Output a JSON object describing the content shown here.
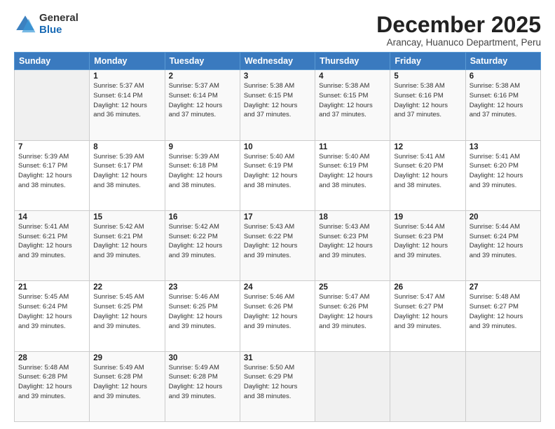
{
  "logo": {
    "general": "General",
    "blue": "Blue"
  },
  "header": {
    "title": "December 2025",
    "subtitle": "Arancay, Huanuco Department, Peru"
  },
  "weekdays": [
    "Sunday",
    "Monday",
    "Tuesday",
    "Wednesday",
    "Thursday",
    "Friday",
    "Saturday"
  ],
  "weeks": [
    [
      {
        "day": "",
        "info": ""
      },
      {
        "day": "1",
        "info": "Sunrise: 5:37 AM\nSunset: 6:14 PM\nDaylight: 12 hours\nand 36 minutes."
      },
      {
        "day": "2",
        "info": "Sunrise: 5:37 AM\nSunset: 6:14 PM\nDaylight: 12 hours\nand 37 minutes."
      },
      {
        "day": "3",
        "info": "Sunrise: 5:38 AM\nSunset: 6:15 PM\nDaylight: 12 hours\nand 37 minutes."
      },
      {
        "day": "4",
        "info": "Sunrise: 5:38 AM\nSunset: 6:15 PM\nDaylight: 12 hours\nand 37 minutes."
      },
      {
        "day": "5",
        "info": "Sunrise: 5:38 AM\nSunset: 6:16 PM\nDaylight: 12 hours\nand 37 minutes."
      },
      {
        "day": "6",
        "info": "Sunrise: 5:38 AM\nSunset: 6:16 PM\nDaylight: 12 hours\nand 37 minutes."
      }
    ],
    [
      {
        "day": "7",
        "info": "Sunrise: 5:39 AM\nSunset: 6:17 PM\nDaylight: 12 hours\nand 38 minutes."
      },
      {
        "day": "8",
        "info": "Sunrise: 5:39 AM\nSunset: 6:17 PM\nDaylight: 12 hours\nand 38 minutes."
      },
      {
        "day": "9",
        "info": "Sunrise: 5:39 AM\nSunset: 6:18 PM\nDaylight: 12 hours\nand 38 minutes."
      },
      {
        "day": "10",
        "info": "Sunrise: 5:40 AM\nSunset: 6:19 PM\nDaylight: 12 hours\nand 38 minutes."
      },
      {
        "day": "11",
        "info": "Sunrise: 5:40 AM\nSunset: 6:19 PM\nDaylight: 12 hours\nand 38 minutes."
      },
      {
        "day": "12",
        "info": "Sunrise: 5:41 AM\nSunset: 6:20 PM\nDaylight: 12 hours\nand 38 minutes."
      },
      {
        "day": "13",
        "info": "Sunrise: 5:41 AM\nSunset: 6:20 PM\nDaylight: 12 hours\nand 39 minutes."
      }
    ],
    [
      {
        "day": "14",
        "info": "Sunrise: 5:41 AM\nSunset: 6:21 PM\nDaylight: 12 hours\nand 39 minutes."
      },
      {
        "day": "15",
        "info": "Sunrise: 5:42 AM\nSunset: 6:21 PM\nDaylight: 12 hours\nand 39 minutes."
      },
      {
        "day": "16",
        "info": "Sunrise: 5:42 AM\nSunset: 6:22 PM\nDaylight: 12 hours\nand 39 minutes."
      },
      {
        "day": "17",
        "info": "Sunrise: 5:43 AM\nSunset: 6:22 PM\nDaylight: 12 hours\nand 39 minutes."
      },
      {
        "day": "18",
        "info": "Sunrise: 5:43 AM\nSunset: 6:23 PM\nDaylight: 12 hours\nand 39 minutes."
      },
      {
        "day": "19",
        "info": "Sunrise: 5:44 AM\nSunset: 6:23 PM\nDaylight: 12 hours\nand 39 minutes."
      },
      {
        "day": "20",
        "info": "Sunrise: 5:44 AM\nSunset: 6:24 PM\nDaylight: 12 hours\nand 39 minutes."
      }
    ],
    [
      {
        "day": "21",
        "info": "Sunrise: 5:45 AM\nSunset: 6:24 PM\nDaylight: 12 hours\nand 39 minutes."
      },
      {
        "day": "22",
        "info": "Sunrise: 5:45 AM\nSunset: 6:25 PM\nDaylight: 12 hours\nand 39 minutes."
      },
      {
        "day": "23",
        "info": "Sunrise: 5:46 AM\nSunset: 6:25 PM\nDaylight: 12 hours\nand 39 minutes."
      },
      {
        "day": "24",
        "info": "Sunrise: 5:46 AM\nSunset: 6:26 PM\nDaylight: 12 hours\nand 39 minutes."
      },
      {
        "day": "25",
        "info": "Sunrise: 5:47 AM\nSunset: 6:26 PM\nDaylight: 12 hours\nand 39 minutes."
      },
      {
        "day": "26",
        "info": "Sunrise: 5:47 AM\nSunset: 6:27 PM\nDaylight: 12 hours\nand 39 minutes."
      },
      {
        "day": "27",
        "info": "Sunrise: 5:48 AM\nSunset: 6:27 PM\nDaylight: 12 hours\nand 39 minutes."
      }
    ],
    [
      {
        "day": "28",
        "info": "Sunrise: 5:48 AM\nSunset: 6:28 PM\nDaylight: 12 hours\nand 39 minutes."
      },
      {
        "day": "29",
        "info": "Sunrise: 5:49 AM\nSunset: 6:28 PM\nDaylight: 12 hours\nand 39 minutes."
      },
      {
        "day": "30",
        "info": "Sunrise: 5:49 AM\nSunset: 6:28 PM\nDaylight: 12 hours\nand 39 minutes."
      },
      {
        "day": "31",
        "info": "Sunrise: 5:50 AM\nSunset: 6:29 PM\nDaylight: 12 hours\nand 38 minutes."
      },
      {
        "day": "",
        "info": ""
      },
      {
        "day": "",
        "info": ""
      },
      {
        "day": "",
        "info": ""
      }
    ]
  ]
}
